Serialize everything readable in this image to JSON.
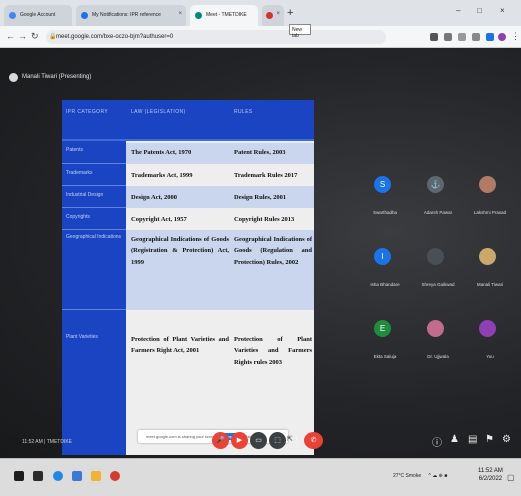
{
  "browser": {
    "tabs": [
      {
        "label": "Google Account",
        "color": "#4285f4"
      },
      {
        "label": "My Notifications: IPR reference",
        "color": "#1a73e8"
      },
      {
        "label": "Meet - TMETDIKE",
        "color": "#00897b"
      },
      {
        "label": "",
        "color": "#d93025"
      }
    ],
    "new_tab_label": "+",
    "tooltip": "New tab",
    "url": "meet.google.com/bxe-oczo-bjm?authuser=0",
    "window_controls": [
      "–",
      "□",
      "×"
    ]
  },
  "meet": {
    "presenter_label": "Manali Tiwari (Presenting)",
    "meeting_info": "11:52 AM | TMETDIKE",
    "participants": [
      {
        "name": "Swarthadha",
        "initial": "S",
        "color": "#1a73e8"
      },
      {
        "name": "Adarsh Pawar",
        "initial": "",
        "color": "#5c6770"
      },
      {
        "name": "Lakshmi Prasad",
        "initial": "",
        "color": "#b07a64"
      },
      {
        "name": "Isha Bhandare",
        "initial": "I",
        "color": "#1a73e8"
      },
      {
        "name": "Shreya Gaikwad",
        "initial": "",
        "color": "#4a4f55"
      },
      {
        "name": "Manali Tiwari",
        "initial": "",
        "color": "#c9a86a"
      },
      {
        "name": "Ekta Saluja",
        "initial": "E",
        "color": "#1e8e3e"
      },
      {
        "name": "Dr. Ujjwala",
        "initial": "",
        "color": "#c26b8a"
      },
      {
        "name": "You",
        "initial": "",
        "color": "#8e3fb4"
      }
    ],
    "controls": {
      "mic": "🎤",
      "camera": "▶",
      "captions": "▭",
      "present": "⬚",
      "more": "⋮",
      "end": "✆"
    },
    "right_controls": [
      "ⓘ",
      "♟",
      "▤",
      "⚑",
      "⚙"
    ]
  },
  "slide": {
    "headers": [
      "IPR CATEGORY",
      "LAW (LEGISLATION)",
      "RULES"
    ],
    "rows": [
      {
        "category": "Patents",
        "act": "The Patents Act, 1970",
        "rule": "Patent Rules, 2003"
      },
      {
        "category": "Trademarks",
        "act": "Trademarks Act, 1999",
        "rule": "Trademark Rules 2017"
      },
      {
        "category": "Industrial Design",
        "act": "Design Act, 2000",
        "rule": "Design Rules, 2001"
      },
      {
        "category": "Copyrights",
        "act": "Copyright Act, 1957",
        "rule": "Copyright Rules 2013"
      },
      {
        "category": "Geographical Indications",
        "act": "Geographical Indications of Goods (Registration & Protection) Act, 1999",
        "rule": "Geographical Indications of Goods (Regulation and Protection) Rules, 2002"
      },
      {
        "category": "Plant Varieties",
        "act": "Protection of Plant Varieties and Farmers Right Act, 2001",
        "rule": "Protection of Plant Varieties and Farmers Rights rules 2003"
      }
    ],
    "share_bar": {
      "text": "meet.google.com is sharing your screen.",
      "stop_label": "Stop sharing",
      "hide_label": "Hide"
    }
  },
  "taskbar": {
    "icons": [
      {
        "name": "windows-start-icon",
        "color": "#1d1d1d"
      },
      {
        "name": "task-view-icon",
        "color": "#2b2b2b"
      },
      {
        "name": "edge-icon",
        "color": "#1e88e5"
      },
      {
        "name": "store-icon",
        "color": "#3b78d8"
      },
      {
        "name": "file-explorer-icon",
        "color": "#f2b233"
      },
      {
        "name": "chrome-icon",
        "color": "#d33b2c"
      }
    ],
    "weather": "27°C Smoke",
    "tray": "^ ☁ ⊕ ■",
    "time": "11:52 AM",
    "date": "6/2/2022"
  }
}
